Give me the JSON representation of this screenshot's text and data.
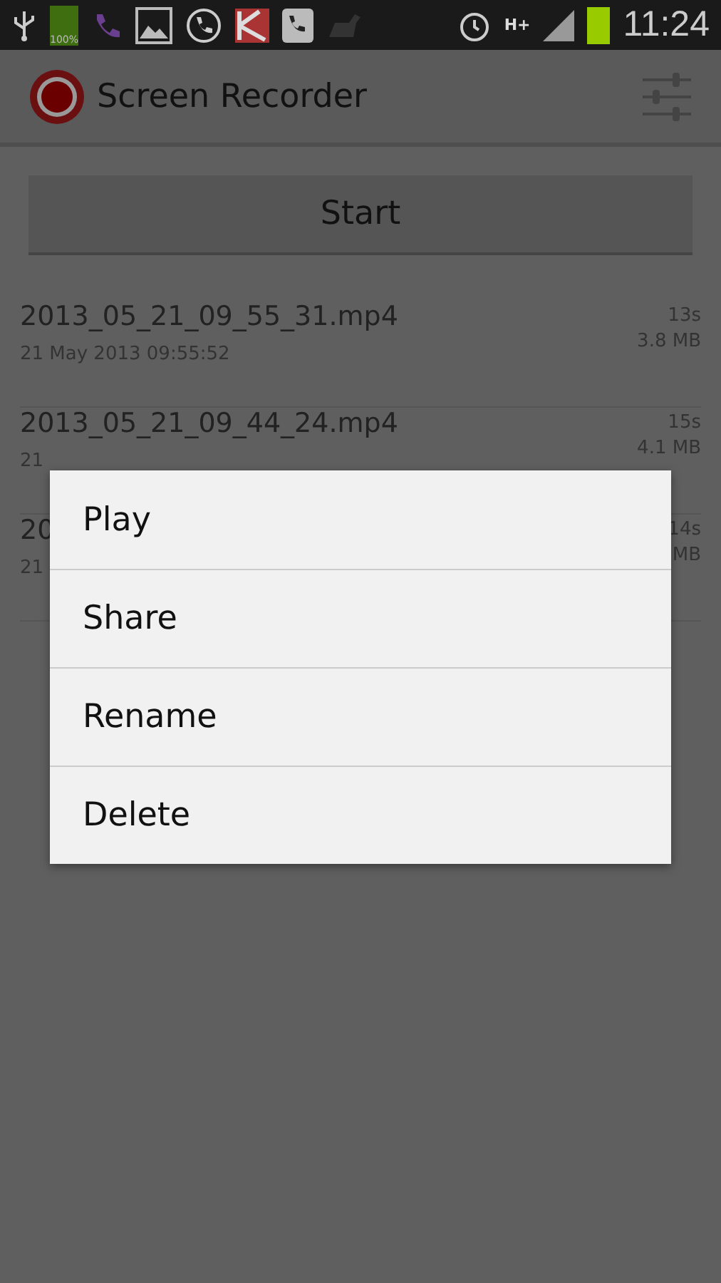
{
  "status_bar": {
    "battery_label": "100%",
    "network": "H+",
    "time": "11:24"
  },
  "action_bar": {
    "title": "Screen Recorder"
  },
  "start_button": "Start",
  "recordings": [
    {
      "name": "2013_05_21_09_55_31.mp4",
      "date": "21 May 2013 09:55:52",
      "duration": "13s",
      "size": "3.8 MB"
    },
    {
      "name": "2013_05_21_09_44_24.mp4",
      "date": "21",
      "duration": "15s",
      "size": "4.1 MB"
    },
    {
      "name": "20",
      "date": "21",
      "duration": "14s",
      "size": "MB"
    }
  ],
  "context_menu": {
    "items": [
      "Play",
      "Share",
      "Rename",
      "Delete"
    ]
  }
}
